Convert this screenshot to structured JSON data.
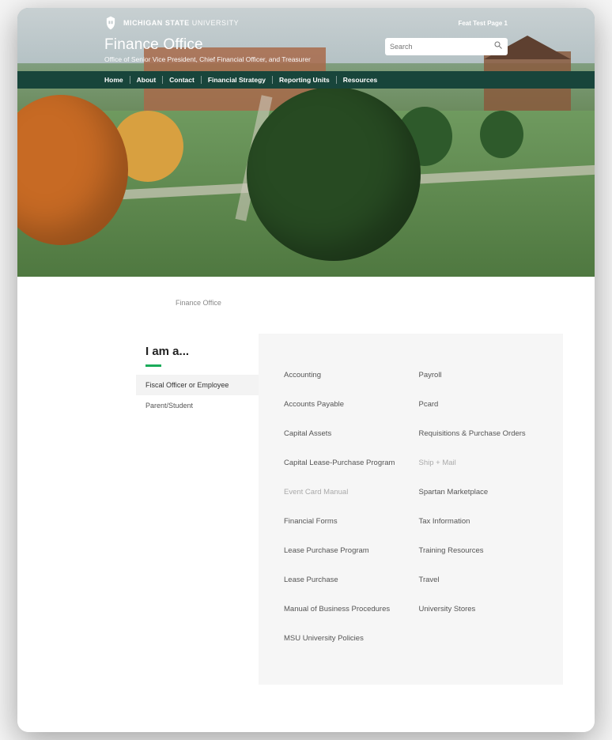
{
  "university": {
    "name_strong": "MICHIGAN STATE",
    "name_light": "UNIVERSITY"
  },
  "feat_label": "Feat   Test Page 1",
  "site": {
    "title": "Finance Office",
    "subtitle": "Office of Senior Vice President, Chief Financial Officer, and Treasurer"
  },
  "search": {
    "placeholder": "Search"
  },
  "nav": {
    "items": [
      "Home",
      "About",
      "Contact",
      "Financial Strategy",
      "Reporting Units",
      "Resources"
    ]
  },
  "breadcrumb": "Finance Office",
  "sidebar": {
    "title": "I am a...",
    "items": [
      {
        "label": "Fiscal Officer or Employee",
        "active": true
      },
      {
        "label": "Parent/Student",
        "active": false
      }
    ]
  },
  "links": {
    "col1": [
      {
        "label": "Accounting"
      },
      {
        "label": "Accounts Payable"
      },
      {
        "label": "Capital Assets"
      },
      {
        "label": "Capital Lease-Purchase Program"
      },
      {
        "label": "Event Card Manual",
        "muted": true
      },
      {
        "label": "Financial Forms"
      },
      {
        "label": "Lease Purchase Program"
      },
      {
        "label": "Lease Purchase"
      },
      {
        "label": "Manual of Business Procedures"
      },
      {
        "label": "MSU University Policies"
      }
    ],
    "col2": [
      {
        "label": "Payroll"
      },
      {
        "label": "Pcard"
      },
      {
        "label": "Requisitions & Purchase Orders"
      },
      {
        "label": "Ship + Mail",
        "muted": true
      },
      {
        "label": "Spartan Marketplace"
      },
      {
        "label": "Tax Information"
      },
      {
        "label": "Training Resources"
      },
      {
        "label": "Travel"
      },
      {
        "label": "University Stores"
      }
    ]
  }
}
